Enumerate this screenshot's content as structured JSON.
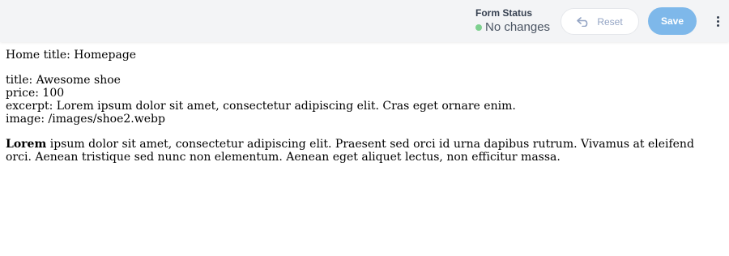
{
  "header": {
    "form_status_label": "Form Status",
    "status_text": "No changes",
    "status_color": "#7ed08f",
    "reset_label": "Reset",
    "save_label": "Save",
    "more_icon": "vertical-dots-icon"
  },
  "content": {
    "home_title": "Home title: Homepage",
    "fields": [
      "title: Awesome shoe",
      "price: 100",
      "excerpt: Lorem ipsum dolor sit amet, consectetur adipiscing elit. Cras eget ornare enim.",
      "image: /images/shoe2.webp"
    ],
    "body_bold": "Lorem",
    "body_rest": " ipsum dolor sit amet, consectetur adipiscing elit. Praesent sed orci id urna dapibus rutrum. Vivamus at eleifend orci. Aenean tristique sed nunc non elementum. Aenean eget aliquet lectus, non efficitur massa."
  }
}
